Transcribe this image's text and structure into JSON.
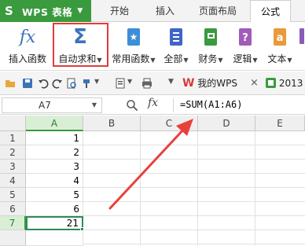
{
  "app": {
    "name": "WPS 表格"
  },
  "tabs": [
    {
      "label": "开始",
      "active": false
    },
    {
      "label": "插入",
      "active": false
    },
    {
      "label": "页面布局",
      "active": false
    },
    {
      "label": "公式",
      "active": true
    }
  ],
  "ribbon": {
    "insert_function": "插入函数",
    "autosum": "自动求和",
    "common_functions": "常用函数",
    "all": "全部",
    "finance": "财务",
    "logic": "逻辑",
    "text": "文本"
  },
  "quickbar": {
    "doc_tab_1": "我的WPS",
    "doc_tab_2_partial": "2013",
    "close_symbol": "×"
  },
  "formula_bar": {
    "name_box": "A7",
    "fx_label": "fx",
    "formula": "=SUM(A1:A6)"
  },
  "grid": {
    "columns": [
      "A",
      "B",
      "C",
      "D",
      "E"
    ],
    "rows": [
      "1",
      "2",
      "3",
      "4",
      "5",
      "6",
      "7"
    ],
    "col_a_values": [
      "1",
      "2",
      "3",
      "4",
      "5",
      "6",
      "21"
    ]
  },
  "colors": {
    "brand_green": "#3a9a3e",
    "highlight_red": "#e23b3b",
    "arrow_red": "#e8413b"
  }
}
